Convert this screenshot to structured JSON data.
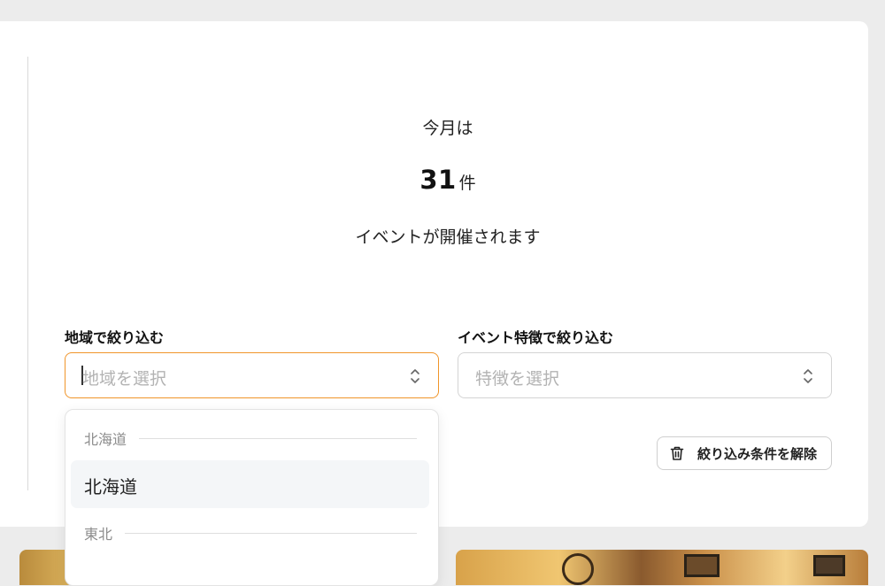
{
  "summary": {
    "lead": "今月は",
    "count": "31",
    "unit": "件",
    "trail": "イベントが開催されます"
  },
  "filters": {
    "region": {
      "label": "地域で絞り込む",
      "placeholder": "地域を選択"
    },
    "feature": {
      "label": "イベント特徴で絞り込む",
      "placeholder": "特徴を選択"
    }
  },
  "dropdown": {
    "groups": [
      {
        "name": "北海道",
        "options": [
          "北海道"
        ]
      },
      {
        "name": "東北"
      }
    ]
  },
  "clear_button": {
    "label": "絞り込み条件を解除",
    "icon": "trash-icon"
  },
  "colors": {
    "focus_border": "#f0952a",
    "option_highlight": "#f4f6f8"
  }
}
